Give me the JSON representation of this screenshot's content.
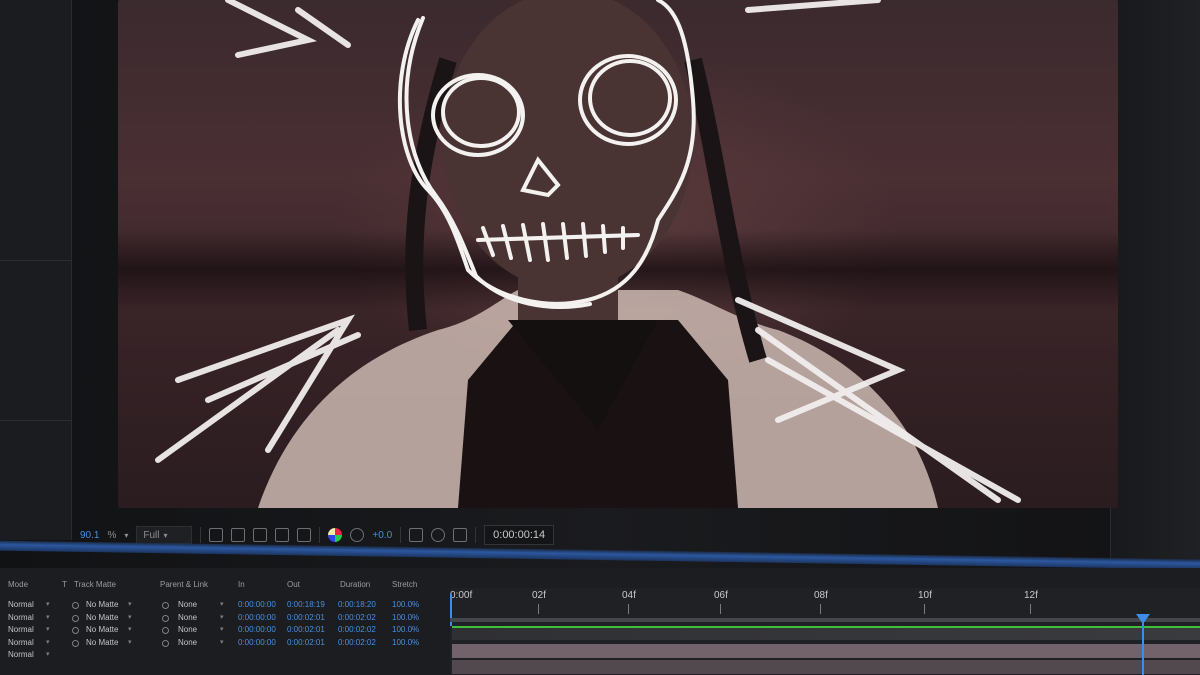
{
  "viewer": {
    "zoom": "90.1",
    "zoom_unit": "%",
    "resolution": "Full",
    "exposure": "+0.0",
    "current_time": "0:00:00:14"
  },
  "timeline": {
    "columns": {
      "mode": "Mode",
      "t": "T",
      "track_matte": "Track Matte",
      "parent_link": "Parent & Link",
      "in": "In",
      "out": "Out",
      "duration": "Duration",
      "stretch": "Stretch"
    },
    "rows": [
      {
        "mode": "Normal",
        "matte": "No Matte",
        "parent": "None",
        "in": "0:00:00:00",
        "out": "0:00:18:19",
        "duration": "0:00:18:20",
        "stretch": "100.0%"
      },
      {
        "mode": "Normal",
        "matte": "No Matte",
        "parent": "None",
        "in": "0:00:00:00",
        "out": "0:00:02:01",
        "duration": "0:00:02:02",
        "stretch": "100.0%"
      },
      {
        "mode": "Normal",
        "matte": "No Matte",
        "parent": "None",
        "in": "0:00:00:00",
        "out": "0:00:02:01",
        "duration": "0:00:02:02",
        "stretch": "100.0%"
      },
      {
        "mode": "Normal",
        "matte": "No Matte",
        "parent": "None",
        "in": "0:00:00:00",
        "out": "0:00:02:01",
        "duration": "0:00:02:02",
        "stretch": "100.0%"
      },
      {
        "mode": "Normal",
        "matte": "",
        "parent": "",
        "in": "",
        "out": "",
        "duration": "",
        "stretch": ""
      }
    ],
    "ruler": [
      "0:00f",
      "02f",
      "04f",
      "06f",
      "08f",
      "10f",
      "12f"
    ]
  },
  "colors": {
    "accent": "#3d8de8",
    "layer_bar_green": "#3fbf3a",
    "timecode_blue": "#4a8fe0"
  },
  "icons": [
    "camera-icon",
    "region-icon",
    "channel-icon",
    "color-wheel-icon",
    "transparency-icon",
    "snapshot-icon",
    "show-snapshot-icon",
    "graph-icon",
    "motion-blur-icon",
    "draft-icon"
  ]
}
